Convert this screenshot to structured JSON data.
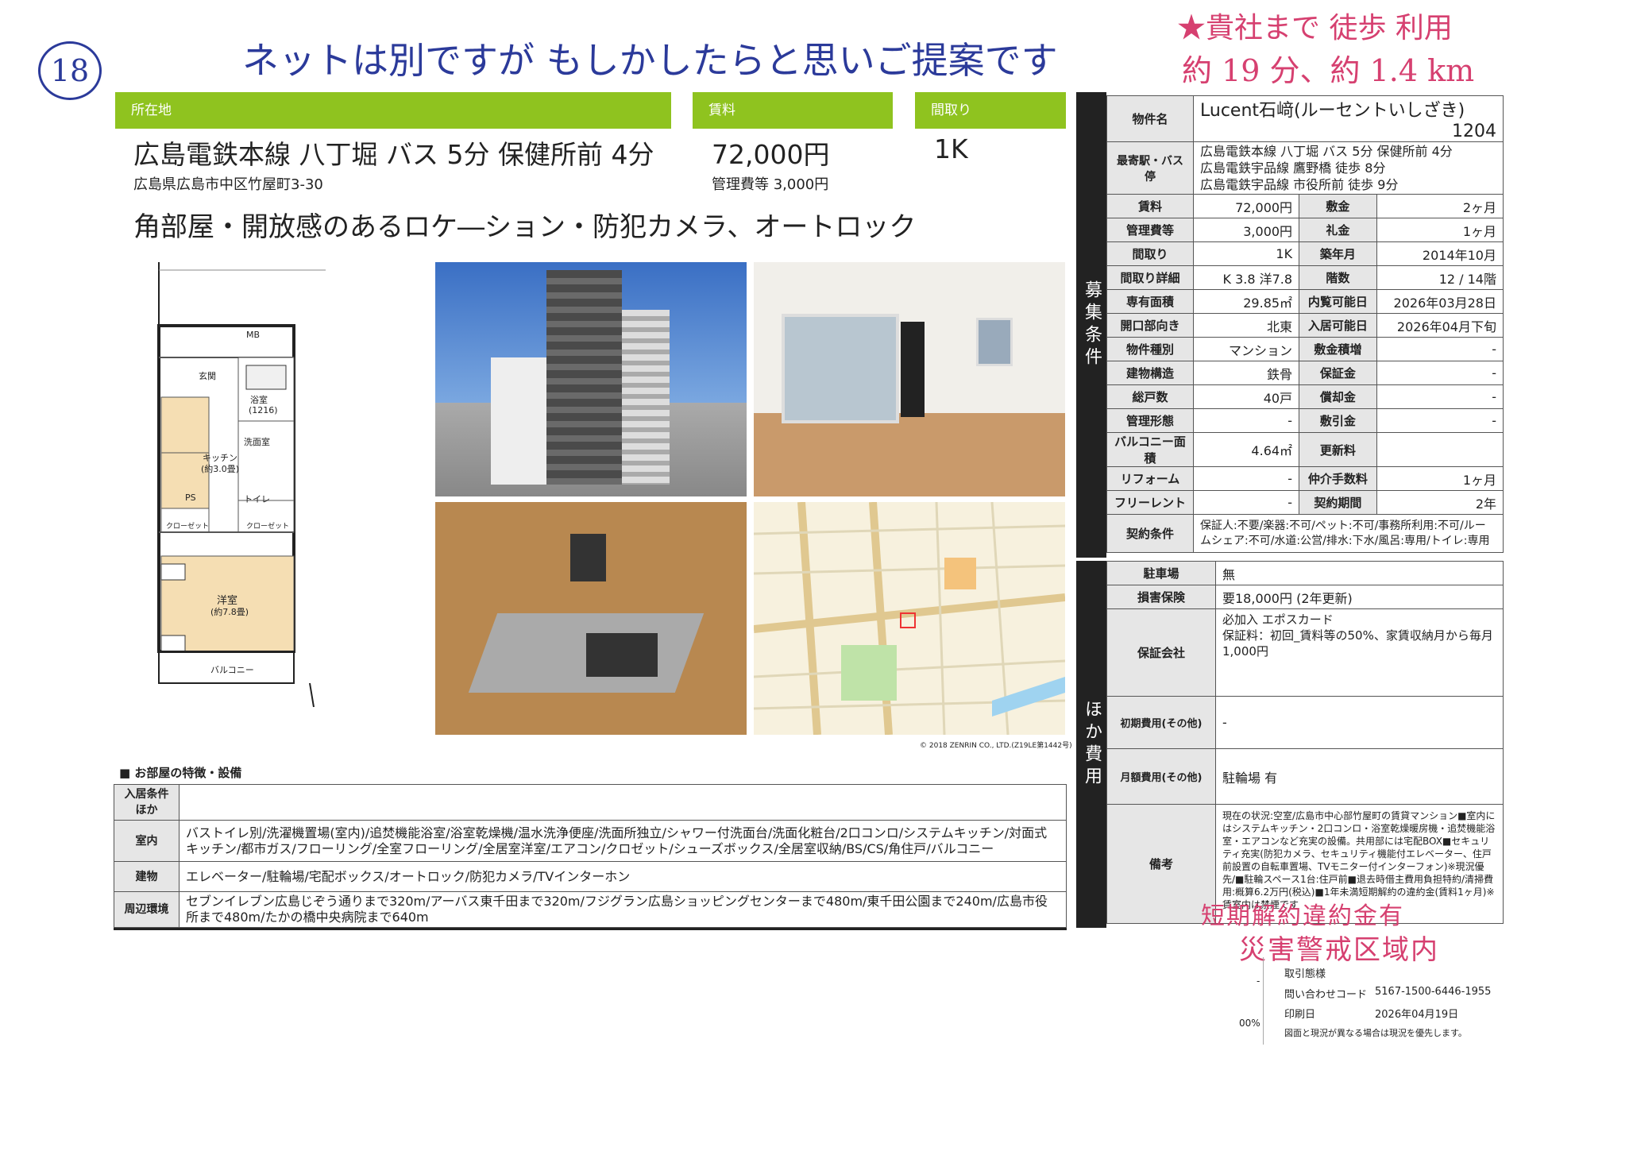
{
  "handwriting": {
    "number": "18",
    "note": "ネットは別ですが もしかしたらと思いご提案です",
    "distance_line1": "★貴社まで 徒歩 利用",
    "distance_line2": "約 19 分、約 1.4 km"
  },
  "headers": {
    "location": "所在地",
    "rent": "賃料",
    "layout": "間取り"
  },
  "summary": {
    "access": "広島電鉄本線 八丁堀 バス 5分 保健所前 4分",
    "address": "広島県広島市中区竹屋町3-30",
    "rent": "72,000円",
    "mgmt": "管理費等 3,000円",
    "layout": "1K",
    "catch": "角部屋・開放感のあるロケ―ション・防犯カメラ、オートロック"
  },
  "floorplan": {
    "genkan": "玄関",
    "bath": "浴室",
    "bath_size": "(1216)",
    "washroom": "洗面室",
    "kitchen": "キッチン",
    "kitchen_size": "(約3.0畳)",
    "ps": "PS",
    "toilet": "トイレ",
    "closet": "クローゼット",
    "room": "洋室",
    "room_size": "(約7.8畳)",
    "balcony": "バルコニー",
    "mb": "MB"
  },
  "map": {
    "copyright": "© 2018 ZENRIN CO., LTD.(Z19LE第1442号)"
  },
  "features": {
    "title": "■ お部屋の特徴・設備",
    "rows": [
      {
        "label": "入居条件ほか",
        "value": ""
      },
      {
        "label": "室内",
        "value": "バストイレ別/洗濯機置場(室内)/追焚機能浴室/浴室乾燥機/温水洗浄便座/洗面所独立/シャワー付洗面台/洗面化粧台/2口コンロ/システムキッチン/対面式キッチン/都市ガス/フローリング/全室フローリング/全居室洋室/エアコン/クロゼット/シューズボックス/全居室収納/BS/CS/角住戸/バルコニー"
      },
      {
        "label": "建物",
        "value": "エレベーター/駐輪場/宅配ボックス/オートロック/防犯カメラ/TVインターホン"
      },
      {
        "label": "周辺環境",
        "value": "セブンイレブン広島じぞう通りまで320m/アーバス東千田まで320m/フジグラン広島ショッピングセンターまで480m/東千田公園まで240m/広島市役所まで480m/たかの橋中央病院まで640m"
      }
    ]
  },
  "side_labels": {
    "recruit": "募集条件",
    "other": "ほか費用"
  },
  "property": {
    "name_label": "物件名",
    "name": "Lucent石﨑(ルーセントいしざき)",
    "room": "1204",
    "station_label": "最寄駅・バス停",
    "stations": [
      "広島電鉄本線 八丁堀 バス 5分 保健所前 4分",
      "広島電鉄宇品線 鷹野橋 徒歩 8分",
      "広島電鉄宇品線 市役所前 徒歩 9分"
    ]
  },
  "spec_rows": [
    [
      "賃料",
      "72,000円",
      "敷金",
      "2ヶ月"
    ],
    [
      "管理費等",
      "3,000円",
      "礼金",
      "1ヶ月"
    ],
    [
      "間取り",
      "1K",
      "築年月",
      "2014年10月"
    ],
    [
      "間取り詳細",
      "K 3.8 洋7.8",
      "階数",
      "12 / 14階"
    ],
    [
      "専有面積",
      "29.85㎡",
      "内覧可能日",
      "2026年03月28日"
    ],
    [
      "開口部向き",
      "北東",
      "入居可能日",
      "2026年04月下旬"
    ],
    [
      "物件種別",
      "マンション",
      "敷金積増",
      "-"
    ],
    [
      "建物構造",
      "鉄骨",
      "保証金",
      "-"
    ],
    [
      "総戸数",
      "40戸",
      "償却金",
      "-"
    ],
    [
      "管理形態",
      "-",
      "敷引金",
      "-"
    ],
    [
      "バルコニー面積",
      "4.64㎡",
      "更新料",
      ""
    ],
    [
      "リフォーム",
      "-",
      "仲介手数料",
      "1ヶ月"
    ],
    [
      "フリーレント",
      "-",
      "契約期間",
      "2年"
    ]
  ],
  "contract": {
    "label": "契約条件",
    "value": "保証人:不要/楽器:不可/ペット:不可/事務所利用:不可/ルームシェア:不可/水道:公営/排水:下水/風呂:専用/トイレ:専用"
  },
  "other_rows": [
    {
      "label": "駐車場",
      "value": "無"
    },
    {
      "label": "損害保険",
      "value": "要18,000円 (2年更新)"
    },
    {
      "label": "保証会社",
      "value": "必加入 エポスカード\n保証料：初回_賃料等の50%、家賃収納月から毎月1,000円"
    },
    {
      "label": "初期費用(その他)",
      "value": "-"
    },
    {
      "label": "月額費用(その他)",
      "value": "駐輪場 有"
    },
    {
      "label": "備考",
      "value": "現在の状況:空室/広島市中心部竹屋町の賃貸マンション■室内にはシステムキッチン・2口コンロ・浴室乾燥暖房機・追焚機能浴室・エアコンなど充実の設備。共用部には宅配BOX■セキュリティ充実(防犯カメラ、セキュリティ機能付エレベーター、住戸前設置の自転車置場、TVモニター付インターフォン)※現況優先/■駐輪スペース1台:住戸前■退去時借主費用負担特約/清掃費用:概算6.2万円(税込)■1年未満短期解約の違約金(賃料1ヶ月)※賃室内は禁煙です"
    }
  ],
  "stamps": {
    "penalty": "短期解約違約金有",
    "disaster": "災害警戒区域内"
  },
  "footer": {
    "to": "取引態様",
    "inquiry_label": "問い合わせコード",
    "inquiry": "5167-1500-6446-1955",
    "print_label": "印刷日",
    "print_date": "2026年04月19日",
    "note": "図面と現況が異なる場合は現況を優先します。",
    "edge_dash": "-",
    "edge_percent": "00%"
  }
}
